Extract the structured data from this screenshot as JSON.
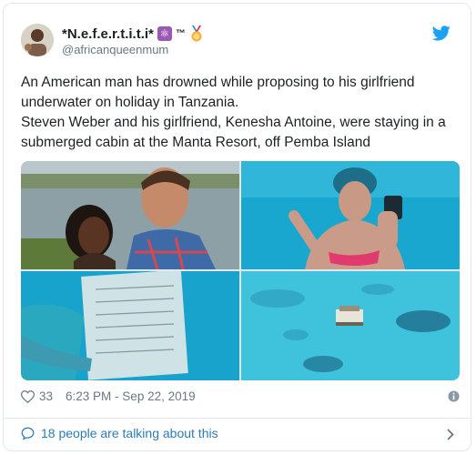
{
  "colors": {
    "link": "#2b7bb9",
    "secondary": "#697882",
    "twitter_blue": "#1da1f2",
    "border": "#e1e8ed"
  },
  "author": {
    "display_name": "*N.e.f.e.r.t.i.t.i*",
    "badges": [
      "atom-icon",
      "trademark",
      "medal-icon"
    ],
    "trademark": "™",
    "handle": "@africanqueenmum",
    "avatar_icon": "avatar"
  },
  "tweet": {
    "text": "An American man has drowned while proposing to his girlfriend underwater on holiday in Tanzania.\nSteven Weber and his girlfriend, Kenesha Antoine, were staying in a submerged cabin at the Manta Resort, off Pemba Island"
  },
  "media": {
    "photos": [
      {
        "icon": "couple-photo"
      },
      {
        "icon": "underwater-ring-photo"
      },
      {
        "icon": "underwater-note-photo"
      },
      {
        "icon": "aerial-cabin-photo"
      }
    ]
  },
  "meta": {
    "like_count": "33",
    "timestamp": "6:23 PM - Sep 22, 2019",
    "heart_icon": "heart-icon",
    "info_icon": "info-icon"
  },
  "conversation": {
    "label": "18 people are talking about this",
    "icon": "speech-bubble-icon"
  }
}
